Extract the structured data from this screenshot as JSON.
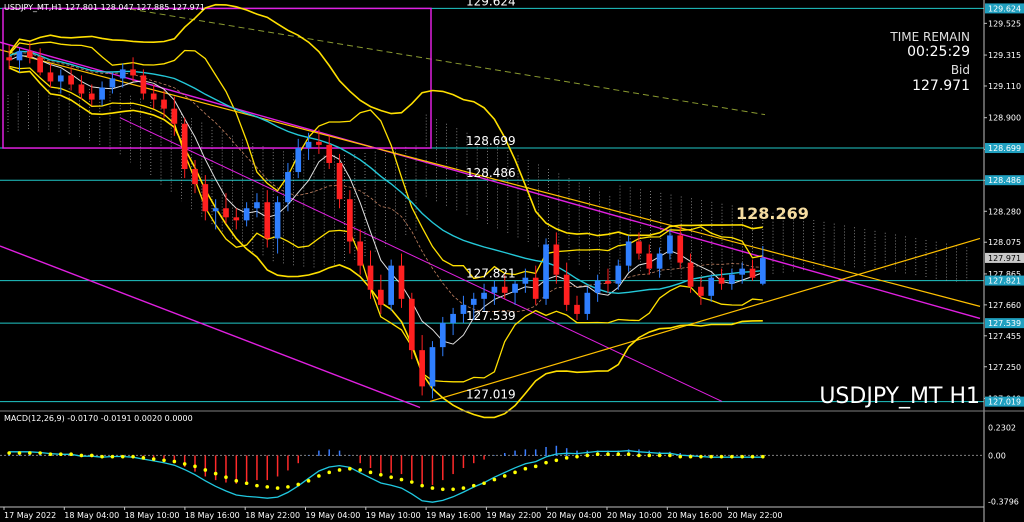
{
  "colors": {
    "background": "#000000",
    "bull": "#2f7fff",
    "bear": "#ff2020",
    "bollinger": "#ffe000",
    "ma_white": "#e0e0e0",
    "ma_cyan": "#24c8d8",
    "trendline_magenta": "#e020e0",
    "trendline_yellow": "#ffc000",
    "level_line": "#20c8c8",
    "macd_hist": "#3a7dff",
    "macd_hist_neg": "#ff2a2a",
    "macd_signal": "#ffff00",
    "macd_line": "#20c8e0",
    "price_tag_bg": "#20a0c0"
  },
  "header": {
    "symbol_line": "USDJPY_MT,H1 127.801 128.047 127.885 127.971"
  },
  "info": {
    "time_remain_label": "TIME REMAIN",
    "time_remain": "00:25:29",
    "bid_label": "Bid",
    "bid": "127.971"
  },
  "watermark": "USDJPY_MT H1",
  "levels": [
    {
      "value": "129.624",
      "y": 129.624
    },
    {
      "value": "128.699",
      "y": 128.699
    },
    {
      "value": "128.486",
      "y": 128.486
    },
    {
      "value": "128.269",
      "y": 128.269
    },
    {
      "value": "127.821",
      "y": 127.821
    },
    {
      "value": "127.539",
      "y": 127.539
    },
    {
      "value": "127.019",
      "y": 127.019
    }
  ],
  "price_axis": {
    "ticks": [
      "129.525",
      "129.315",
      "129.110",
      "128.900",
      "128.690",
      "128.485",
      "128.280",
      "128.075",
      "127.865",
      "127.660",
      "127.455",
      "127.250",
      "127.040"
    ],
    "tick_values": [
      129.525,
      129.315,
      129.11,
      128.9,
      128.69,
      128.485,
      128.28,
      128.075,
      127.865,
      127.66,
      127.455,
      127.25,
      127.04
    ],
    "tags": [
      "129.624",
      "128.699",
      "128.486",
      "127.971",
      "127.821",
      "127.539",
      "127.019"
    ],
    "tag_values": [
      129.624,
      128.699,
      128.486,
      127.971,
      127.821,
      127.539,
      127.019
    ],
    "ymin": 126.99,
    "ymax": 129.64
  },
  "time_axis": {
    "labels": [
      "17 May 2022",
      "18 May 04:00",
      "18 May 10:00",
      "18 May 16:00",
      "18 May 22:00",
      "19 May 04:00",
      "19 May 10:00",
      "19 May 16:00",
      "19 May 22:00",
      "20 May 04:00",
      "20 May 10:00",
      "20 May 16:00",
      "20 May 22:00"
    ]
  },
  "macd": {
    "label": "MACD(12,26,9) -0.0170 -0.0191 0.0020 0.0000",
    "ticks": [
      "0.2302",
      "0.00",
      "-0.3796"
    ],
    "tick_values": [
      0.2302,
      0.0,
      -0.3796
    ],
    "ymin": -0.41,
    "ymax": 0.26
  },
  "chart_data": {
    "type": "candlestick",
    "title": "USDJPY_MT H1",
    "x": [
      "17 May 2022",
      "18 May 04:00",
      "18 May 10:00",
      "18 May 16:00",
      "18 May 22:00",
      "19 May 04:00",
      "19 May 10:00",
      "19 May 16:00",
      "19 May 22:00",
      "20 May 04:00",
      "20 May 10:00",
      "20 May 16:00",
      "20 May 22:00"
    ],
    "ohlc": [
      [
        129.3,
        129.38,
        129.22,
        129.28
      ],
      [
        129.28,
        129.36,
        129.2,
        129.34
      ],
      [
        129.34,
        129.4,
        129.26,
        129.3
      ],
      [
        129.3,
        129.36,
        129.18,
        129.2
      ],
      [
        129.2,
        129.26,
        129.1,
        129.14
      ],
      [
        129.14,
        129.22,
        129.06,
        129.18
      ],
      [
        129.18,
        129.24,
        129.08,
        129.12
      ],
      [
        129.12,
        129.18,
        129.02,
        129.06
      ],
      [
        129.06,
        129.12,
        128.98,
        129.02
      ],
      [
        129.02,
        129.14,
        128.98,
        129.1
      ],
      [
        129.1,
        129.2,
        129.06,
        129.16
      ],
      [
        129.16,
        129.26,
        129.1,
        129.22
      ],
      [
        129.22,
        129.3,
        129.14,
        129.18
      ],
      [
        129.18,
        129.22,
        129.02,
        129.06
      ],
      [
        129.06,
        129.12,
        128.96,
        129.02
      ],
      [
        129.02,
        129.08,
        128.9,
        128.96
      ],
      [
        128.96,
        129.04,
        128.78,
        128.86
      ],
      [
        128.86,
        128.9,
        128.5,
        128.56
      ],
      [
        128.56,
        128.62,
        128.4,
        128.46
      ],
      [
        128.46,
        128.52,
        128.22,
        128.28
      ],
      [
        128.28,
        128.36,
        128.16,
        128.3
      ],
      [
        128.3,
        128.4,
        128.2,
        128.24
      ],
      [
        128.24,
        128.3,
        128.16,
        128.22
      ],
      [
        128.22,
        128.34,
        128.18,
        128.3
      ],
      [
        128.3,
        128.4,
        128.24,
        128.34
      ],
      [
        128.34,
        128.42,
        128.04,
        128.1
      ],
      [
        128.1,
        128.38,
        128.0,
        128.34
      ],
      [
        128.34,
        128.6,
        128.28,
        128.54
      ],
      [
        128.54,
        128.76,
        128.5,
        128.7
      ],
      [
        128.7,
        128.8,
        128.62,
        128.74
      ],
      [
        128.74,
        128.82,
        128.66,
        128.72
      ],
      [
        128.72,
        128.78,
        128.56,
        128.6
      ],
      [
        128.6,
        128.66,
        128.3,
        128.36
      ],
      [
        128.36,
        128.42,
        128.0,
        128.08
      ],
      [
        128.08,
        128.16,
        127.86,
        127.92
      ],
      [
        127.92,
        128.02,
        127.7,
        127.76
      ],
      [
        127.76,
        127.86,
        127.6,
        127.66
      ],
      [
        127.66,
        127.96,
        127.62,
        127.92
      ],
      [
        127.92,
        128.0,
        127.64,
        127.7
      ],
      [
        127.7,
        127.74,
        127.3,
        127.36
      ],
      [
        127.36,
        127.46,
        127.06,
        127.12
      ],
      [
        127.12,
        127.42,
        127.04,
        127.38
      ],
      [
        127.38,
        127.58,
        127.32,
        127.54
      ],
      [
        127.54,
        127.64,
        127.46,
        127.6
      ],
      [
        127.6,
        127.72,
        127.54,
        127.66
      ],
      [
        127.66,
        127.74,
        127.56,
        127.7
      ],
      [
        127.7,
        127.8,
        127.62,
        127.74
      ],
      [
        127.74,
        127.82,
        127.66,
        127.78
      ],
      [
        127.78,
        127.86,
        127.7,
        127.74
      ],
      [
        127.74,
        127.82,
        127.66,
        127.8
      ],
      [
        127.8,
        127.9,
        127.74,
        127.84
      ],
      [
        127.84,
        127.92,
        127.66,
        127.7
      ],
      [
        127.7,
        128.1,
        127.66,
        128.06
      ],
      [
        128.06,
        128.14,
        127.8,
        127.86
      ],
      [
        127.86,
        127.94,
        127.62,
        127.66
      ],
      [
        127.66,
        127.72,
        127.56,
        127.6
      ],
      [
        127.6,
        127.78,
        127.56,
        127.74
      ],
      [
        127.74,
        127.86,
        127.68,
        127.82
      ],
      [
        127.82,
        127.9,
        127.74,
        127.8
      ],
      [
        127.8,
        127.96,
        127.76,
        127.92
      ],
      [
        127.92,
        128.12,
        127.88,
        128.08
      ],
      [
        128.08,
        128.14,
        127.96,
        128.0
      ],
      [
        128.0,
        128.06,
        127.86,
        127.9
      ],
      [
        127.9,
        128.04,
        127.84,
        128.0
      ],
      [
        128.0,
        128.16,
        127.96,
        128.12
      ],
      [
        128.12,
        128.18,
        127.9,
        127.94
      ],
      [
        127.94,
        128.0,
        127.74,
        127.78
      ],
      [
        127.78,
        127.84,
        127.66,
        127.72
      ],
      [
        127.72,
        127.86,
        127.68,
        127.84
      ],
      [
        127.84,
        127.9,
        127.76,
        127.8
      ],
      [
        127.8,
        127.9,
        127.76,
        127.86
      ],
      [
        127.86,
        127.94,
        127.8,
        127.9
      ],
      [
        127.9,
        127.96,
        127.82,
        127.84
      ],
      [
        127.8,
        128.05,
        127.79,
        127.97
      ]
    ],
    "macd_histogram": [
      0.02,
      0.02,
      0.02,
      0.01,
      0.01,
      0.0,
      0.0,
      -0.01,
      -0.01,
      -0.01,
      0.0,
      0.0,
      -0.01,
      -0.02,
      -0.03,
      -0.04,
      -0.06,
      -0.09,
      -0.13,
      -0.17,
      -0.2,
      -0.22,
      -0.23,
      -0.22,
      -0.2,
      -0.2,
      -0.17,
      -0.12,
      -0.06,
      0.0,
      0.04,
      0.05,
      0.04,
      -0.0,
      -0.06,
      -0.1,
      -0.14,
      -0.14,
      -0.15,
      -0.2,
      -0.25,
      -0.24,
      -0.2,
      -0.15,
      -0.1,
      -0.06,
      -0.03,
      0.0,
      0.02,
      0.04,
      0.05,
      0.05,
      0.07,
      0.08,
      0.06,
      0.04,
      0.04,
      0.04,
      0.04,
      0.04,
      0.05,
      0.05,
      0.04,
      0.03,
      0.03,
      0.02,
      0.01,
      0.0,
      -0.01,
      -0.01,
      -0.01,
      -0.01,
      -0.01,
      -0.01
    ],
    "macd_signal": [
      0.02,
      0.02,
      0.02,
      0.02,
      0.01,
      0.01,
      0.01,
      0.0,
      0.0,
      -0.01,
      -0.01,
      -0.01,
      -0.01,
      -0.02,
      -0.03,
      -0.04,
      -0.05,
      -0.07,
      -0.09,
      -0.12,
      -0.15,
      -0.18,
      -0.21,
      -0.23,
      -0.25,
      -0.26,
      -0.27,
      -0.26,
      -0.24,
      -0.21,
      -0.17,
      -0.14,
      -0.12,
      -0.11,
      -0.12,
      -0.14,
      -0.16,
      -0.18,
      -0.2,
      -0.22,
      -0.25,
      -0.27,
      -0.28,
      -0.28,
      -0.27,
      -0.25,
      -0.23,
      -0.2,
      -0.17,
      -0.14,
      -0.11,
      -0.09,
      -0.06,
      -0.04,
      -0.02,
      -0.01,
      0.0,
      0.01,
      0.01,
      0.01,
      0.01,
      0.0,
      0.0,
      0.0,
      0.0,
      -0.01,
      -0.01,
      -0.01,
      -0.01,
      -0.01,
      -0.01,
      -0.01,
      -0.01,
      -0.01
    ]
  }
}
